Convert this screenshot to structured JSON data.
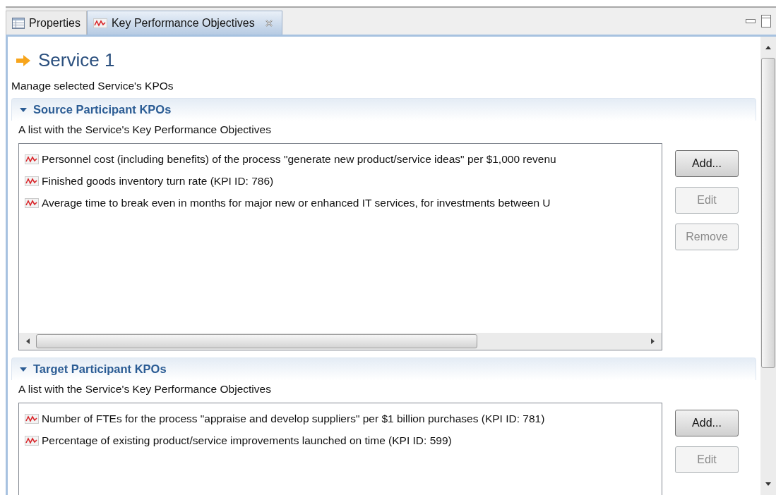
{
  "tabs": [
    {
      "label": "Properties",
      "kind": "table",
      "selected": false,
      "closable": false
    },
    {
      "label": "Key Performance Objectives",
      "kind": "kpo",
      "selected": true,
      "closable": true
    }
  ],
  "header": {
    "title": "Service 1",
    "subtitle": "Manage selected Service's KPOs"
  },
  "sections": [
    {
      "title": "Source Participant KPOs",
      "expanded": true,
      "description": "A list with the Service's Key Performance Objectives",
      "horizontal_scrollbar": true,
      "items": [
        "Personnel cost (including benefits) of the process \"generate new product/service ideas\" per $1,000 revenu",
        "Finished goods inventory turn rate (KPI ID: 786)",
        "Average time to break even in months for major new or enhanced IT services, for investments between U"
      ],
      "buttons": [
        {
          "label": "Add...",
          "disabled": false
        },
        {
          "label": "Edit",
          "disabled": true
        },
        {
          "label": "Remove",
          "disabled": true
        }
      ]
    },
    {
      "title": "Target Participant KPOs",
      "expanded": true,
      "description": "A list with the Service's Key Performance Objectives",
      "horizontal_scrollbar": false,
      "items": [
        "Number of FTEs for the process \"appraise and develop suppliers\" per $1 billion purchases (KPI ID: 781)",
        "Percentage of existing product/service improvements launched on time (KPI ID: 599)"
      ],
      "buttons": [
        {
          "label": "Add...",
          "disabled": false
        },
        {
          "label": "Edit",
          "disabled": true
        }
      ]
    }
  ]
}
